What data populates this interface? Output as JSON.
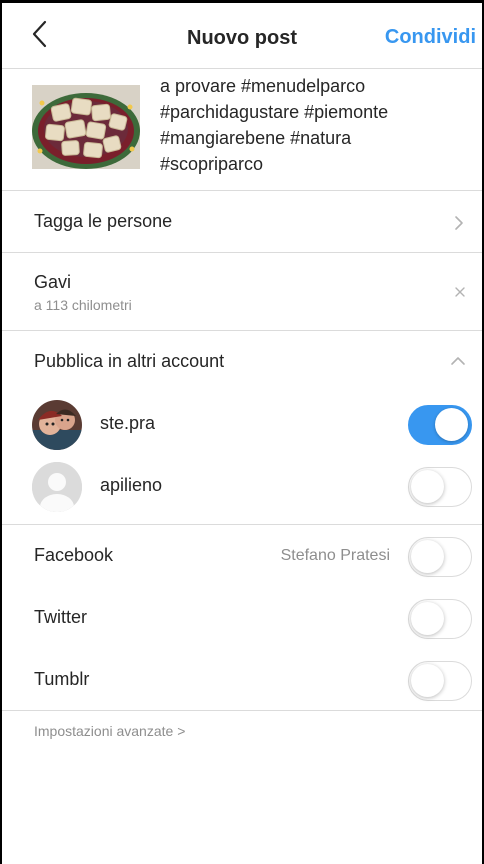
{
  "header": {
    "title": "Nuovo post",
    "share_label": "Condividi",
    "back_icon": "chevron-left-icon",
    "accent_color": "#3897f0"
  },
  "post": {
    "caption_lines": [
      "a provare #menudelparco",
      "#parchidagustare #piemonte",
      "#mangiarebene #natura",
      "#scopriparco"
    ]
  },
  "tag_people": {
    "label": "Tagga le persone"
  },
  "location": {
    "name": "Gavi",
    "distance": "a 113 chilometri"
  },
  "other_accounts": {
    "label": "Pubblica in altri account",
    "accounts": [
      {
        "name": "ste.pra",
        "enabled": true
      },
      {
        "name": "apilieno",
        "enabled": false
      }
    ]
  },
  "social": [
    {
      "name": "Facebook",
      "value": "Stefano Pratesi",
      "enabled": false
    },
    {
      "name": "Twitter",
      "value": "",
      "enabled": false
    },
    {
      "name": "Tumblr",
      "value": "",
      "enabled": false
    }
  ],
  "advanced_settings": {
    "label": "Impostazioni avanzate >"
  }
}
